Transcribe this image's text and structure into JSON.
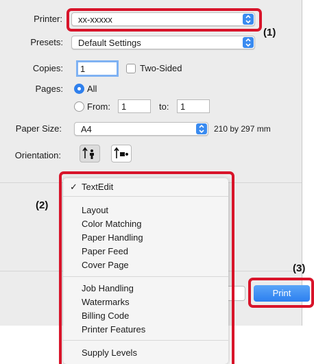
{
  "printer": {
    "label": "Printer:",
    "value": "xx-xxxxx"
  },
  "presets": {
    "label": "Presets:",
    "value": "Default Settings"
  },
  "copies": {
    "label": "Copies:",
    "value": "1",
    "two_sided_label": "Two-Sided",
    "two_sided_checked": false
  },
  "pages": {
    "label": "Pages:",
    "all_label": "All",
    "from_label": "From:",
    "from_value": "1",
    "to_label": "to:",
    "to_value": "1",
    "selected": "All"
  },
  "paper_size": {
    "label": "Paper Size:",
    "value": "A4",
    "dimensions": "210 by 297 mm"
  },
  "orientation": {
    "label": "Orientation:",
    "selected": "portrait"
  },
  "panel_menu": {
    "checked_item": "TextEdit",
    "groups": [
      [
        "TextEdit"
      ],
      [
        "Layout",
        "Color Matching",
        "Paper Handling",
        "Paper Feed",
        "Cover Page"
      ],
      [
        "Job Handling",
        "Watermarks",
        "Billing Code",
        "Printer Features"
      ],
      [
        "Supply Levels"
      ]
    ]
  },
  "buttons": {
    "print_label": "Print"
  },
  "callouts": {
    "one": "(1)",
    "two": "(2)",
    "three": "(3)"
  },
  "colors": {
    "accent": "#3a8bf0",
    "highlight": "#d8142a"
  }
}
